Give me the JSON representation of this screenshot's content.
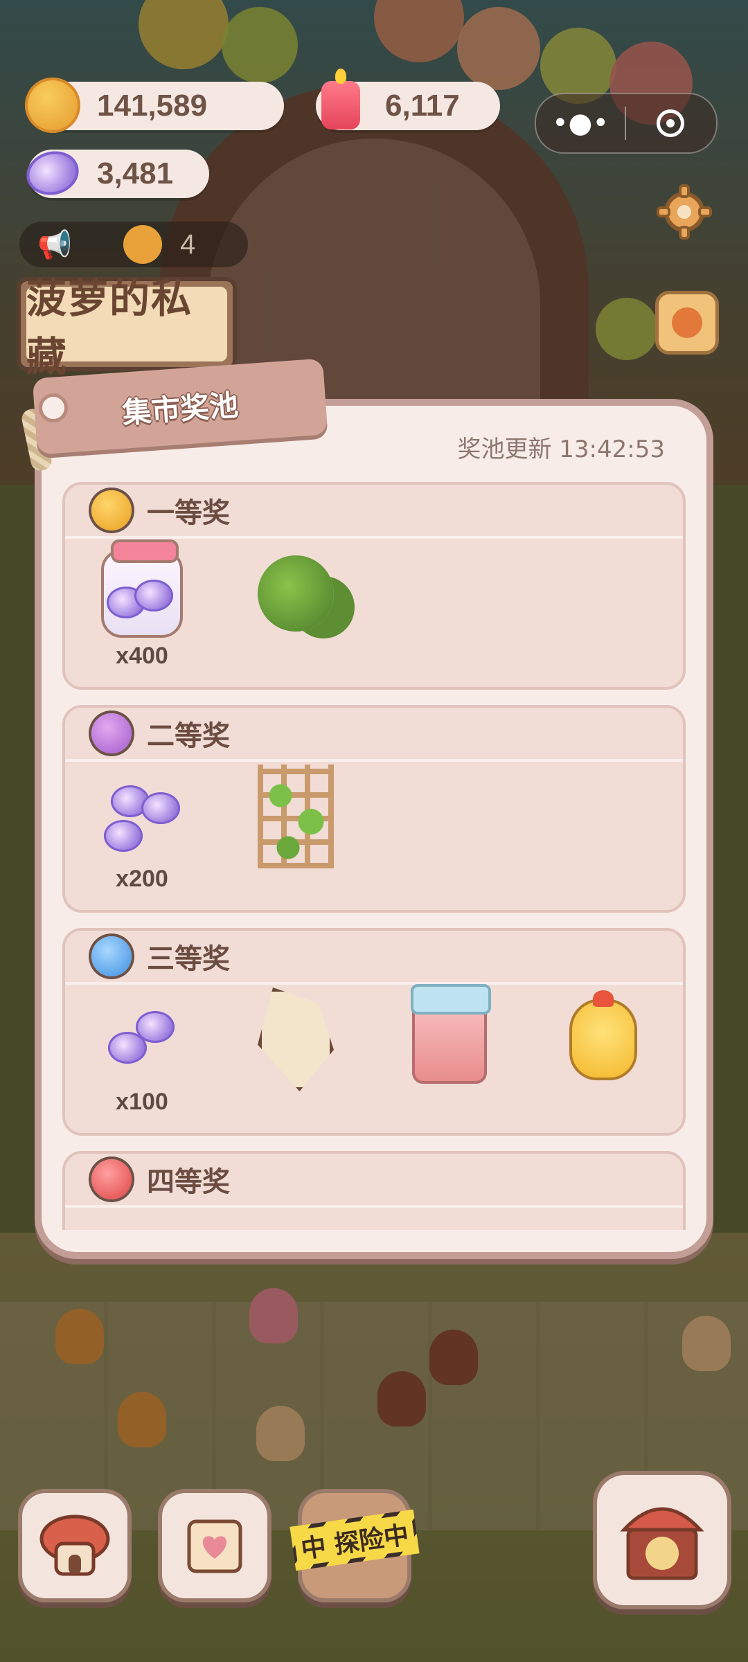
{
  "resources": {
    "cookies": "141,589",
    "candles": "6,117",
    "gems": "3,481"
  },
  "announcement": {
    "count": "4"
  },
  "miniprogram_capsule": {
    "more_icon": "more-dots-icon",
    "close_icon": "target-icon"
  },
  "shop_sign": {
    "text": "菠萝的私藏"
  },
  "panel": {
    "title": "集市奖池",
    "refresh_label": "奖池更新 13:42:53",
    "tiers": [
      {
        "name": "一等奖",
        "color": "#f0b429",
        "items": [
          {
            "icon": "gem-jar-icon",
            "qty": "x400"
          },
          {
            "icon": "tree-swing-icon",
            "qty": ""
          }
        ]
      },
      {
        "name": "二等奖",
        "color": "#b97ad6",
        "items": [
          {
            "icon": "gem-pile-icon",
            "qty": "x200"
          },
          {
            "icon": "flower-trellis-icon",
            "qty": ""
          }
        ]
      },
      {
        "name": "三等奖",
        "color": "#5aa9f0",
        "items": [
          {
            "icon": "gem-pair-icon",
            "qty": "x100"
          },
          {
            "icon": "kite-icon",
            "qty": ""
          },
          {
            "icon": "sink-icon",
            "qty": ""
          },
          {
            "icon": "chick-plush-icon",
            "qty": ""
          }
        ]
      },
      {
        "name": "四等奖",
        "color": "#ef5a5a",
        "items": []
      }
    ]
  },
  "bottom_bar": {
    "exploring_label": "中 探险中"
  }
}
